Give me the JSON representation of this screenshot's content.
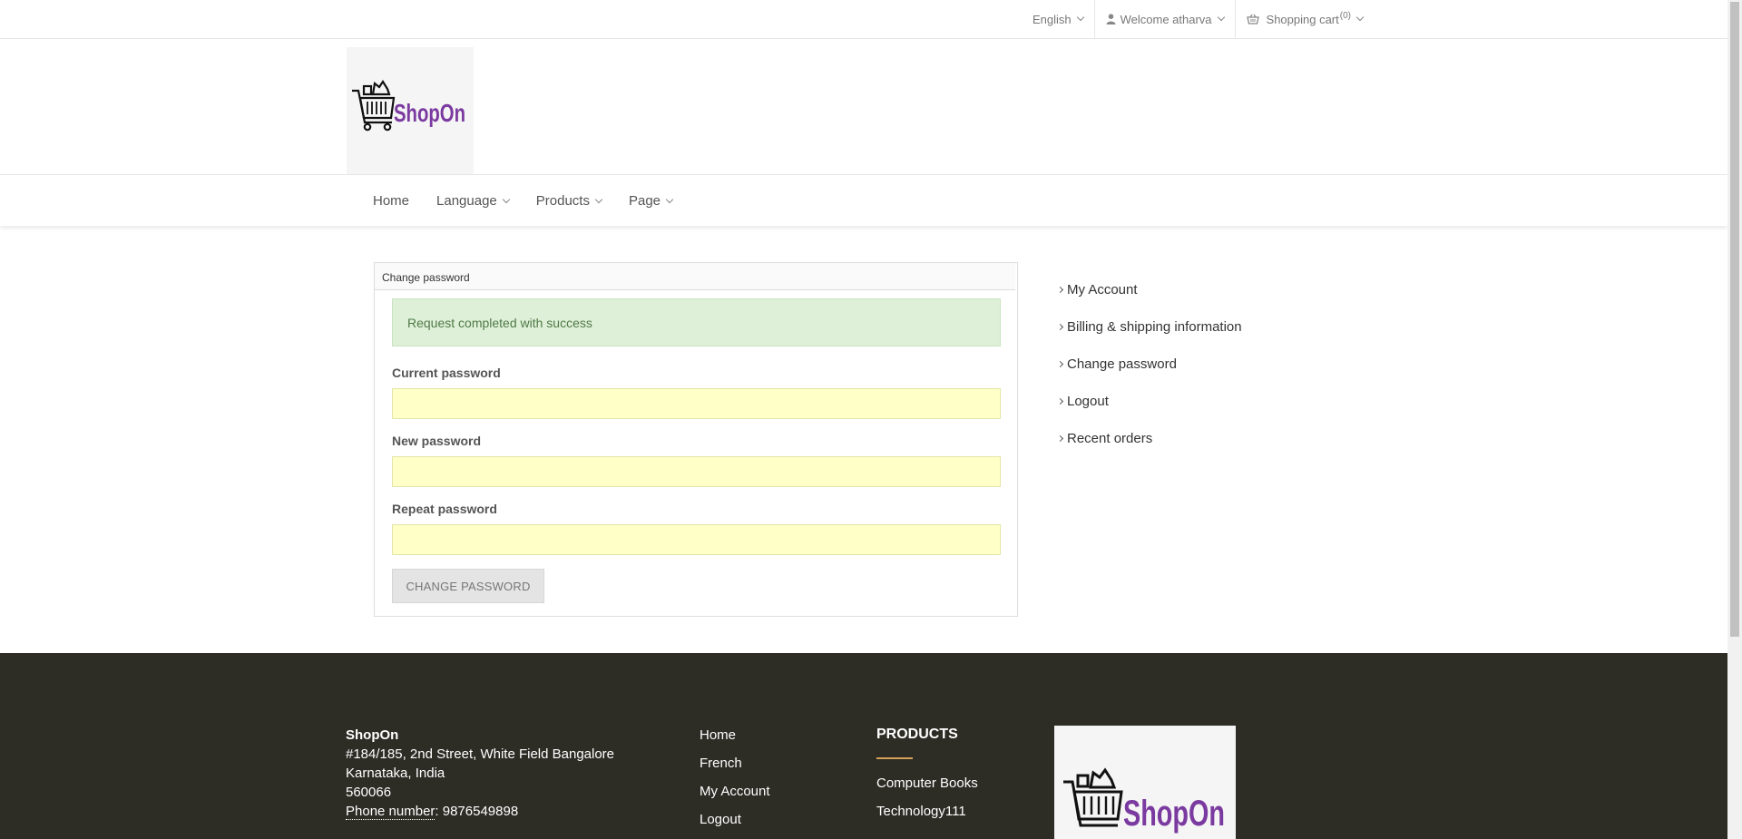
{
  "topbar": {
    "language": "English",
    "welcome": "Welcome atharva",
    "cart_label": "Shopping cart",
    "cart_count": "(0)"
  },
  "logo": {
    "text": "ShopOn"
  },
  "nav": [
    {
      "label": "Home"
    },
    {
      "label": "Language"
    },
    {
      "label": "Products"
    },
    {
      "label": "Page"
    }
  ],
  "form": {
    "title": "Change password",
    "alert": "Request completed with success",
    "current_label": "Current password",
    "new_label": "New password",
    "repeat_label": "Repeat password",
    "current_value": "",
    "new_value": "",
    "repeat_value": "",
    "submit_label": "Change password"
  },
  "side_menu": [
    {
      "label": "My Account"
    },
    {
      "label": "Billing & shipping information"
    },
    {
      "label": "Change password"
    },
    {
      "label": "Logout"
    },
    {
      "label": "Recent orders"
    }
  ],
  "footer": {
    "store_name": "ShopOn",
    "address_line1": "#184/185, 2nd Street, White Field Bangalore",
    "address_line2": "Karnataka, India",
    "postcode": "560066",
    "phone_label": "Phone number",
    "phone_value": ": 9876549898",
    "links": [
      {
        "label": "Home"
      },
      {
        "label": "French"
      },
      {
        "label": "My Account"
      },
      {
        "label": "Logout"
      }
    ],
    "products_title": "PRODUCTS",
    "products": [
      {
        "label": "Computer Books"
      },
      {
        "label": "Technology111"
      }
    ]
  },
  "colors": {
    "footer_bg": "#2d2c25",
    "logo_purple": "#7b3aa0",
    "alert_bg": "#dff0d8",
    "input_bg": "#ffffc8"
  }
}
